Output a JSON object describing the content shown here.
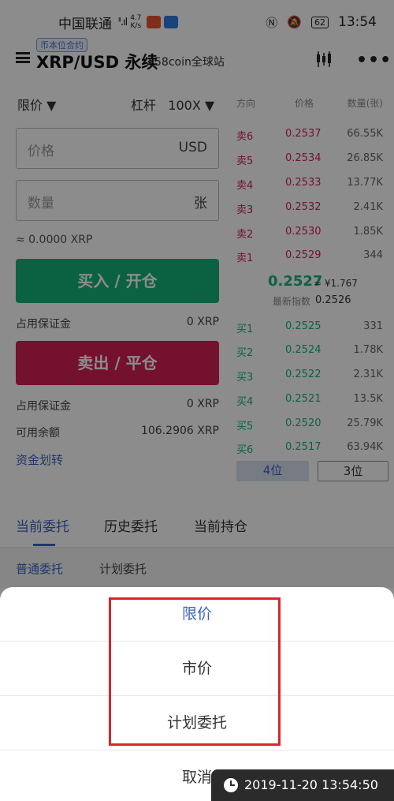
{
  "status_bar": {
    "carrier": "中国联通",
    "network": "4G",
    "speed_value": "4.7",
    "speed_unit": "K/s",
    "battery": "62",
    "time": "13:54"
  },
  "header": {
    "tag": "币本位合约",
    "title": "XRP/USD 永续",
    "subtitle": "58coin全球站"
  },
  "order_form": {
    "order_type": "限价 ▼",
    "leverage_label": "杠杆",
    "leverage_value": "100X ▼",
    "price_placeholder": "价格",
    "price_unit": "USD",
    "qty_placeholder": "数量",
    "qty_unit": "张",
    "approx": "≈ 0.0000 XRP",
    "buy_label": "买入 / 开仓",
    "buy_margin_label": "占用保证金",
    "buy_margin_value": "0 XRP",
    "sell_label": "卖出 / 平仓",
    "sell_margin_label": "占用保证金",
    "sell_margin_value": "0 XRP",
    "available_label": "可用余额",
    "available_value": "106.2906 XRP",
    "transfer_label": "资金划转"
  },
  "order_book": {
    "headers": [
      "方向",
      "价格",
      "数量(张)"
    ],
    "asks": [
      {
        "side": "卖6",
        "price": "0.2537",
        "amount": "66.55K"
      },
      {
        "side": "卖5",
        "price": "0.2534",
        "amount": "26.85K"
      },
      {
        "side": "卖4",
        "price": "0.2533",
        "amount": "13.77K"
      },
      {
        "side": "卖3",
        "price": "0.2532",
        "amount": "2.41K"
      },
      {
        "side": "卖2",
        "price": "0.2530",
        "amount": "1.85K"
      },
      {
        "side": "卖1",
        "price": "0.2529",
        "amount": "344"
      }
    ],
    "last_price": "0.2527",
    "last_price_cny": "≈ ¥1.767",
    "index_label": "最新指数",
    "index_value": "0.2526",
    "bids": [
      {
        "side": "买1",
        "price": "0.2525",
        "amount": "331"
      },
      {
        "side": "买2",
        "price": "0.2524",
        "amount": "1.78K"
      },
      {
        "side": "买3",
        "price": "0.2522",
        "amount": "2.31K"
      },
      {
        "side": "买4",
        "price": "0.2521",
        "amount": "13.5K"
      },
      {
        "side": "买5",
        "price": "0.2520",
        "amount": "25.79K"
      },
      {
        "side": "买6",
        "price": "0.2517",
        "amount": "63.94K"
      }
    ],
    "depth_a": "4位",
    "depth_b": "3位"
  },
  "tabs": {
    "current": "当前委托",
    "history": "历史委托",
    "positions": "当前持仓"
  },
  "subtabs": {
    "normal": "普通委托",
    "plan": "计划委托"
  },
  "sheet": {
    "limit": "限价",
    "market": "市价",
    "plan": "计划委托",
    "cancel": "取消"
  },
  "timestamp": "2019-11-20 13:54:50",
  "colors": {
    "buy": "#14b27b",
    "sell": "#d41f57",
    "accent": "#3c63c4",
    "highlight": "#d9252b"
  }
}
